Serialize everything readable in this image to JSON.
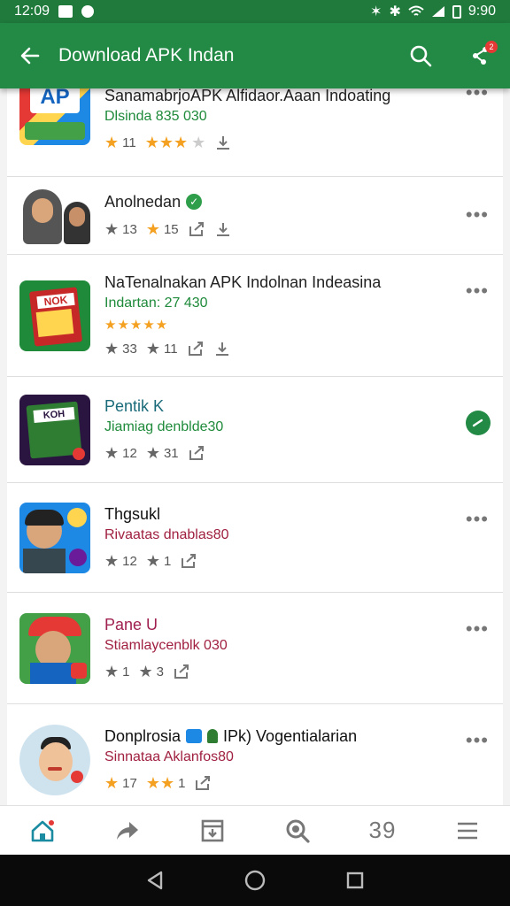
{
  "status_bar": {
    "time": "12:09",
    "right_text": "9:90"
  },
  "app_bar": {
    "title": "Download APK Indan",
    "notif_count": "2"
  },
  "items": [
    {
      "name": "SanamabrjoAPK Alfidaor.Aaan Indoating",
      "sub": "Dlsinda 835 030",
      "sub_color": "#1e8a3a",
      "stat1": "11",
      "stat2": ""
    },
    {
      "name": "Anolnedan",
      "sub": "",
      "sub_color": "#555555",
      "stat1": "13",
      "stat2": "15"
    },
    {
      "name": "NaTenalnakan APK Indolnan Indeasina",
      "sub": "Indartan: 27 430",
      "sub_color": "#1e8a3a",
      "stat1": "33",
      "stat2": "11"
    },
    {
      "name": "Pentik K",
      "sub": "Jiamiag denblde30",
      "sub_color": "#1e8a3a",
      "stat1": "12",
      "stat2": "31"
    },
    {
      "name": "Thgsukl",
      "sub": "Rivaatas dnablas80",
      "sub_color": "#a02040",
      "stat1": "12",
      "stat2": "1"
    },
    {
      "name": "Pane U",
      "sub": "Stiamlaycenblk 030",
      "sub_color": "#a02040",
      "stat1": "1",
      "stat2": "3"
    },
    {
      "name": "Donplrosia",
      "name_suffix": "IPk) Vogentialarian",
      "sub": "Sinnataa Aklanfos80",
      "sub_color": "#a02040",
      "stat1": "17",
      "stat2": "1"
    }
  ],
  "bottom_nav": {
    "scan_label": "39"
  },
  "colors": {
    "primary": "#238a45",
    "accent_gold": "#f4a020"
  }
}
